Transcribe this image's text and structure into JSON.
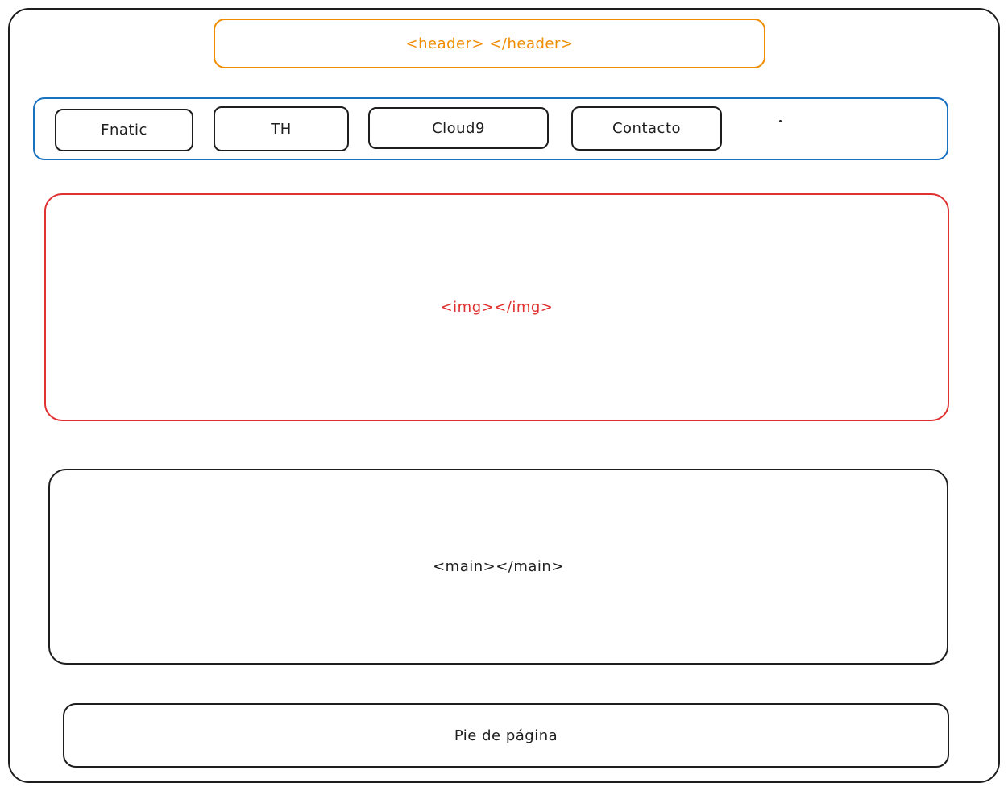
{
  "header": {
    "label": "<header> </header>"
  },
  "nav": {
    "items": [
      {
        "label": "Fnatic"
      },
      {
        "label": "TH"
      },
      {
        "label": "Cloud9"
      },
      {
        "label": "Contacto"
      }
    ]
  },
  "image_block": {
    "label": "<img></img>"
  },
  "main_block": {
    "label": "<main></main>"
  },
  "footer": {
    "label": "Pie de página"
  },
  "colors": {
    "header_stroke": "#f08c00",
    "nav_stroke": "#1971c2",
    "image_stroke": "#e03131",
    "default_stroke": "#1e1e1e"
  }
}
